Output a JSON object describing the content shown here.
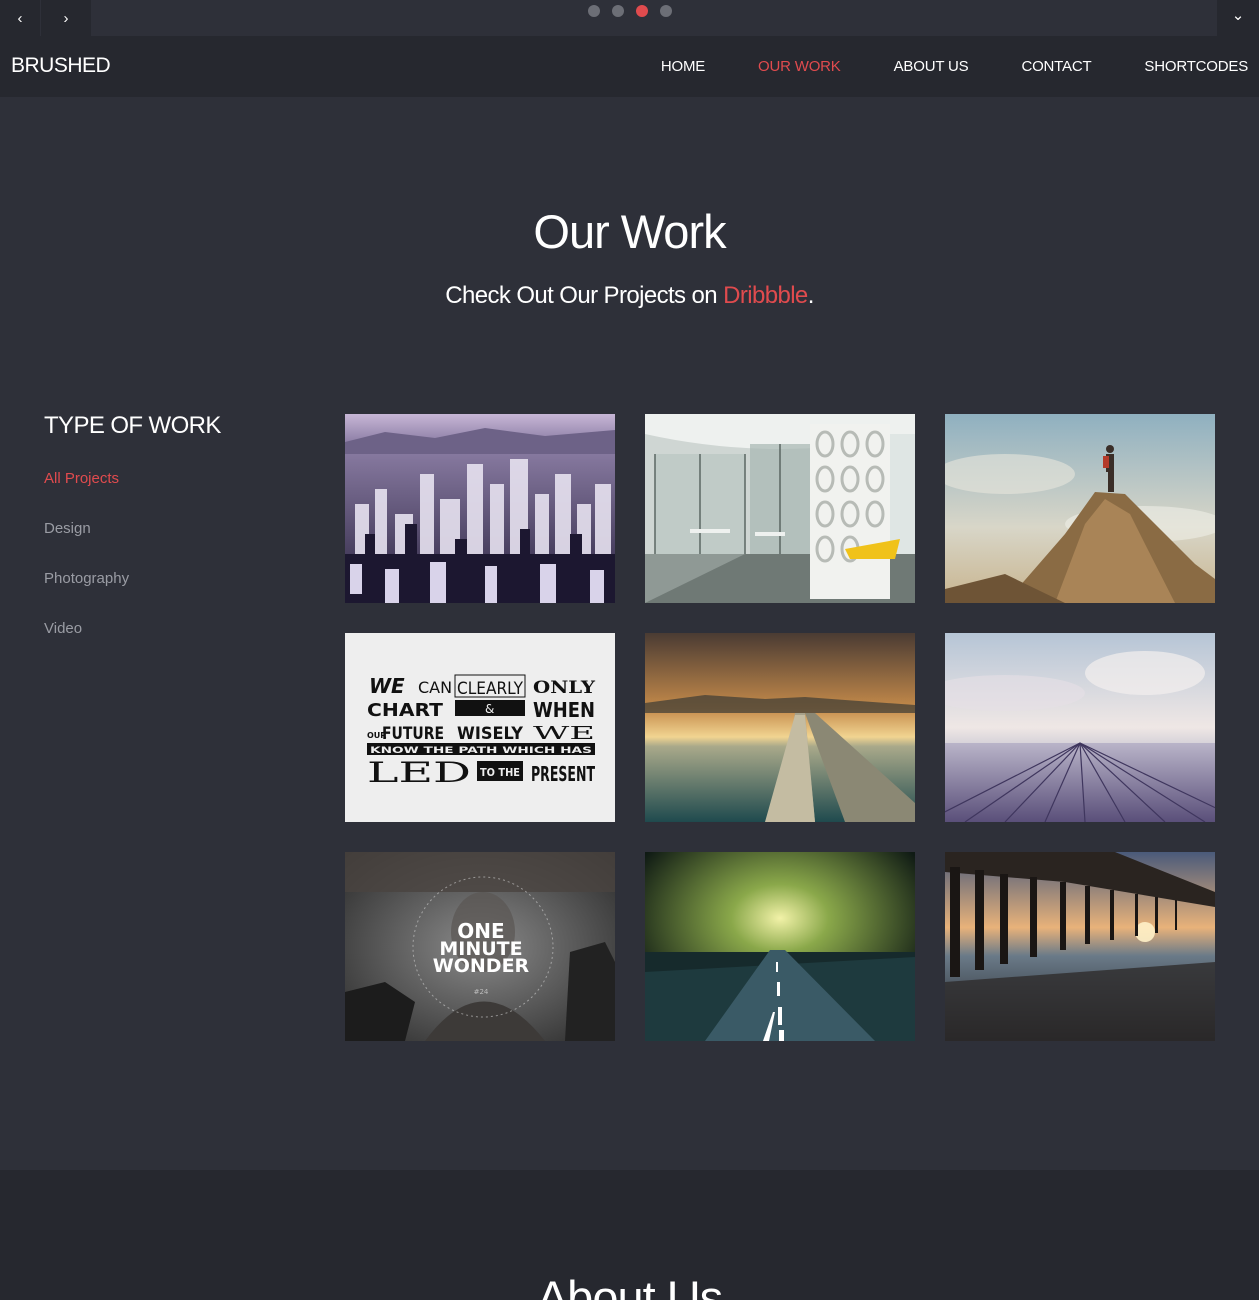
{
  "slider": {
    "prev_icon": "chevron-left-icon",
    "next_icon": "chevron-right-icon",
    "menu_icon": "chevron-down-icon",
    "dots": [
      {
        "active": false
      },
      {
        "active": false
      },
      {
        "active": true
      },
      {
        "active": false
      }
    ],
    "prev_label": "‹",
    "next_label": "›",
    "menu_label": "⌄"
  },
  "header": {
    "brand": "BRUSHED",
    "nav": [
      {
        "label": "HOME",
        "active": false
      },
      {
        "label": "OUR WORK",
        "active": true
      },
      {
        "label": "ABOUT US",
        "active": false
      },
      {
        "label": "CONTACT",
        "active": false
      },
      {
        "label": "SHORTCODES",
        "active": false
      }
    ]
  },
  "work": {
    "title": "Our Work",
    "subtitle_prefix": "Check Out Our Projects on ",
    "subtitle_link": "Dribbble",
    "subtitle_suffix": "."
  },
  "filter": {
    "title": "TYPE OF WORK",
    "items": [
      {
        "label": "All Projects",
        "active": true
      },
      {
        "label": "Design",
        "active": false
      },
      {
        "label": "Photography",
        "active": false
      },
      {
        "label": "Video",
        "active": false
      }
    ]
  },
  "projects": [
    {
      "name": "city-skyline"
    },
    {
      "name": "office-interior"
    },
    {
      "name": "hiker-on-rock"
    },
    {
      "name": "typography-poster",
      "lines": [
        "WE",
        "CAN",
        "CLEARLY",
        "ONLY",
        "CHART",
        "&",
        "WHEN",
        "OUR",
        "FUTURE",
        "WISELY",
        "WE",
        "KNOW THE PATH WHICH HAS",
        "LED",
        "TO THE",
        "PRESENT"
      ]
    },
    {
      "name": "pier-at-sunset"
    },
    {
      "name": "wooden-deck-sky"
    },
    {
      "name": "one-minute-wonder",
      "lines": [
        "ONE",
        "MINUTE",
        "WONDER",
        "#24"
      ]
    },
    {
      "name": "road-storm"
    },
    {
      "name": "beach-pier"
    }
  ],
  "about": {
    "title": "About Us"
  },
  "colors": {
    "accent": "#e04b4e",
    "background": "#2e3039",
    "navbar": "#26282f"
  }
}
